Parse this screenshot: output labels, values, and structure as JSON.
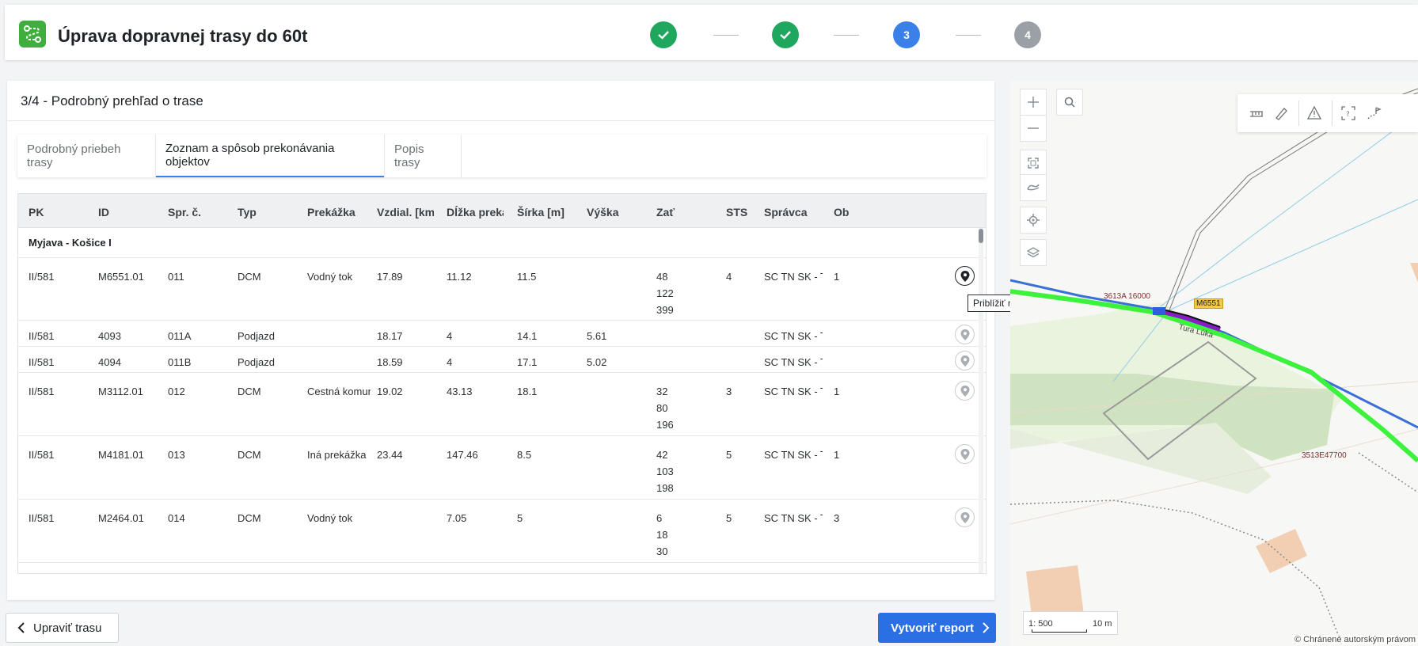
{
  "header": {
    "title": "Úprava dopravnej trasy do 60t",
    "steps": [
      {
        "label": "✓",
        "state": "done"
      },
      {
        "label": "✓",
        "state": "done"
      },
      {
        "label": "3",
        "state": "active"
      },
      {
        "label": "4",
        "state": "pending"
      }
    ]
  },
  "panel": {
    "title": "3/4 - Podrobný prehľad o trase",
    "tabs": [
      {
        "label": "Podrobný priebeh trasy"
      },
      {
        "label": "Zoznam a spôsob prekonávania objektov"
      },
      {
        "label": "Popis trasy"
      }
    ]
  },
  "table": {
    "columns": [
      "PK",
      "ID",
      "Spr. č.",
      "Typ",
      "Prekážka",
      "Vzdial. [km]",
      "Dĺžka prekážky",
      "Šírka [m]",
      "Výška",
      "Zať",
      "STS",
      "Správca",
      "Ob"
    ],
    "group": "Myjava - Košice I",
    "rows": [
      {
        "pk": "II/581",
        "id": "M6551.01",
        "spr": "011",
        "typ": "DCM",
        "prekazka": "Vodný tok",
        "vzdial": "17.89",
        "dlzka": "11.12",
        "sirka": "11.5",
        "vyska": "",
        "zat": "48\n122\n399",
        "sts": "4",
        "spravca": "SC TN SK - TN",
        "ob": "1"
      },
      {
        "pk": "II/581",
        "id": "4093",
        "spr": "011A",
        "typ": "Podjazd",
        "prekazka": "",
        "vzdial": "18.17",
        "dlzka": "4",
        "sirka": "14.1",
        "vyska": "5.61",
        "zat": "",
        "sts": "",
        "spravca": "SC TN SK - TN",
        "ob": ""
      },
      {
        "pk": "II/581",
        "id": "4094",
        "spr": "011B",
        "typ": "Podjazd",
        "prekazka": "",
        "vzdial": "18.59",
        "dlzka": "4",
        "sirka": "17.1",
        "vyska": "5.02",
        "zat": "",
        "sts": "",
        "spravca": "SC TN SK - TN",
        "ob": ""
      },
      {
        "pk": "II/581",
        "id": "M3112.01",
        "spr": "012",
        "typ": "DCM",
        "prekazka": "Cestná komunikácia",
        "vzdial": "19.02",
        "dlzka": "43.13",
        "sirka": "18.1",
        "vyska": "",
        "zat": "32\n80\n196",
        "sts": "3",
        "spravca": "SC TN SK - TN",
        "ob": "1"
      },
      {
        "pk": "II/581",
        "id": "M4181.01",
        "spr": "013",
        "typ": "DCM",
        "prekazka": "Iná prekážka",
        "vzdial": "23.44",
        "dlzka": "147.46",
        "sirka": "8.5",
        "vyska": "",
        "zat": "42\n103\n198",
        "sts": "5",
        "spravca": "SC TN SK - TN",
        "ob": "1"
      },
      {
        "pk": "II/581",
        "id": "M2464.01",
        "spr": "014",
        "typ": "DCM",
        "prekazka": "Vodný tok",
        "vzdial": "",
        "dlzka": "7.05",
        "sirka": "5",
        "vyska": "",
        "zat": "6\n18\n30",
        "sts": "5",
        "spravca": "SC TN SK - TN",
        "ob": "3"
      }
    ],
    "tooltip": "Priblížiť na"
  },
  "buttons": {
    "back": "Upraviť trasu",
    "report": "Vytvoriť report"
  },
  "map": {
    "labels": {
      "parcel1": "3613A 16000",
      "bridge": "M6551",
      "street": "Tura Lúka",
      "parcel2": "3513E47700"
    },
    "scale": {
      "ratio": "1: 500",
      "distance": "10 m"
    },
    "copyright": "© Chránené autorským právom",
    "colors": {
      "route": "#3df23d",
      "road": "#3a6fd8",
      "highlight": "#8a1cc4"
    }
  }
}
